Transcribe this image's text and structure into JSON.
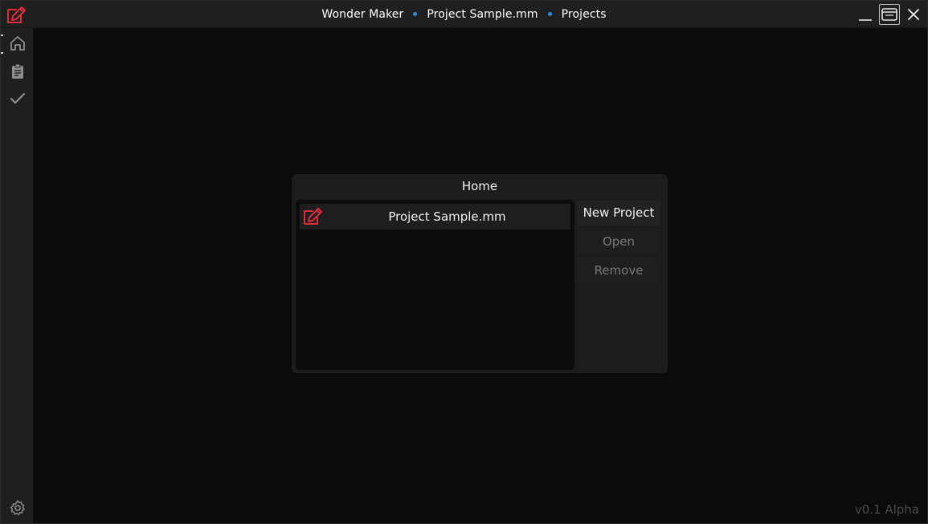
{
  "titlebar": {
    "app_name": "Wonder Maker",
    "project_name": "Project Sample.mm",
    "section": "Projects",
    "separator_color": "#2f8ad6"
  },
  "icons": {
    "app_logo": "edit-document-icon",
    "minimize": "minimize-icon",
    "maximize": "window-maximize-icon",
    "close": "close-icon",
    "home": "home-icon",
    "documents": "clipboard-icon",
    "tasks": "check-icon",
    "settings": "gear-icon"
  },
  "colors": {
    "accent": "#e02b3a",
    "background": "#0b0b0b",
    "panel": "#1c1c1c",
    "sidebar": "#1f1f1f"
  },
  "home_panel": {
    "title": "Home",
    "projects": [
      {
        "name": "Project Sample.mm"
      }
    ],
    "buttons": {
      "new_project": "New Project",
      "open": "Open",
      "remove": "Remove"
    }
  },
  "footer": {
    "version": "v0.1 Alpha"
  }
}
